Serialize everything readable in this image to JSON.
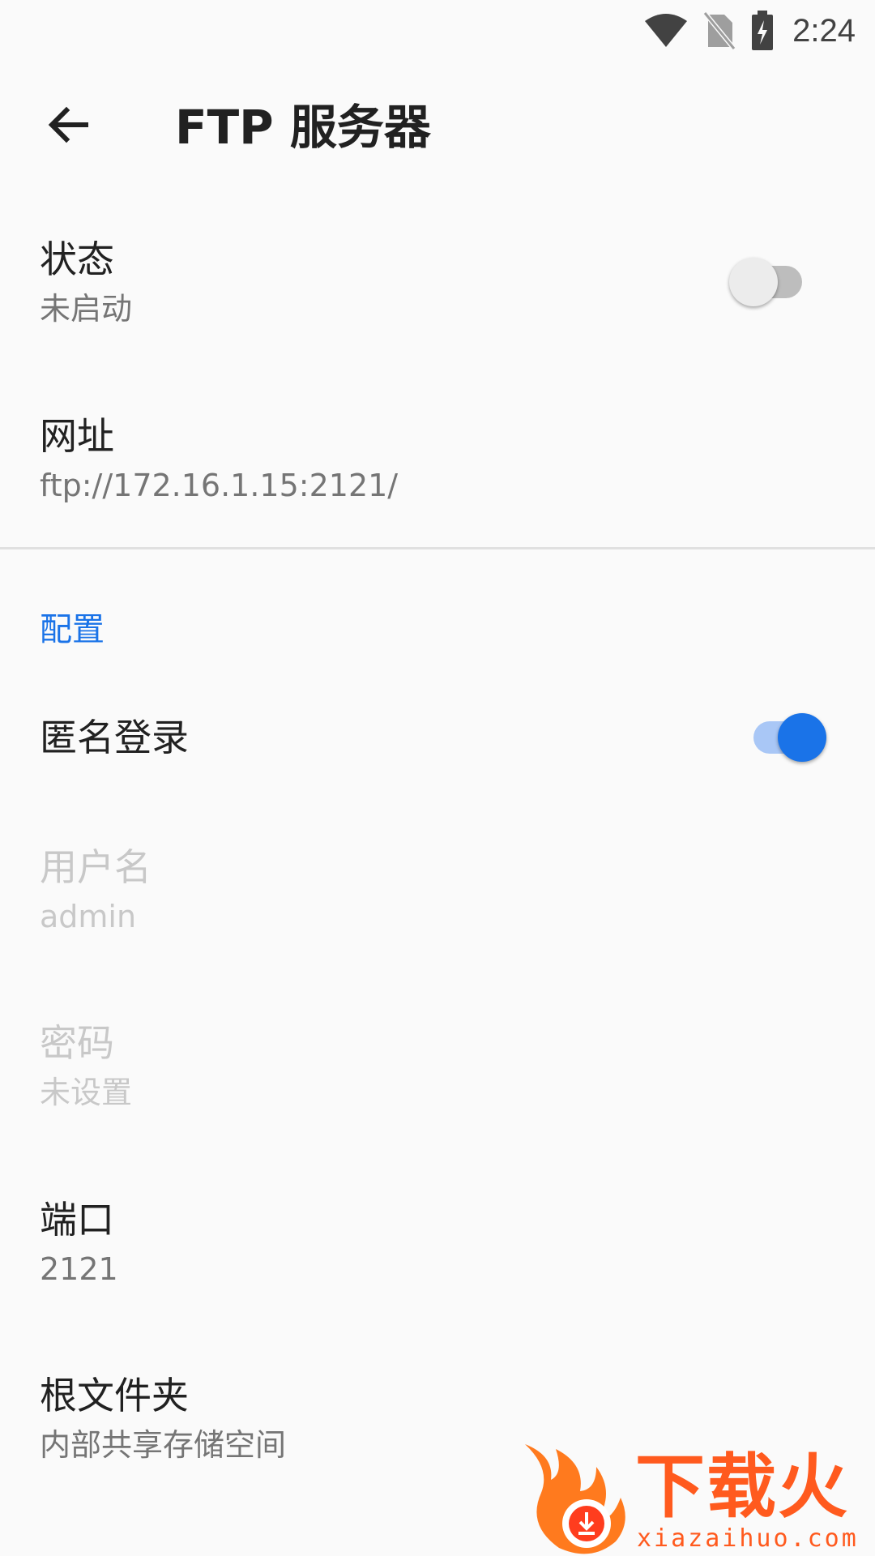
{
  "status_bar": {
    "time": "2:24",
    "icons": [
      "wifi-icon",
      "no-sim-icon",
      "battery-charging-icon"
    ]
  },
  "app_bar": {
    "back_icon": "arrow-back-icon",
    "title": "FTP 服务器"
  },
  "status": {
    "title": "状态",
    "summary": "未启动",
    "enabled": false
  },
  "url": {
    "title": "网址",
    "summary": "ftp://172.16.1.15:2121/"
  },
  "config": {
    "header": "配置",
    "anonymous_login": {
      "title": "匿名登录",
      "enabled": true
    },
    "username": {
      "title": "用户名",
      "summary": "admin",
      "disabled": true
    },
    "password": {
      "title": "密码",
      "summary": "未设置",
      "disabled": true
    },
    "port": {
      "title": "端口",
      "summary": "2121"
    },
    "root_folder": {
      "title": "根文件夹",
      "summary": "内部共享存储空间"
    }
  },
  "watermark": {
    "brand": "下载火",
    "domain": "xiazaihuo.com"
  },
  "colors": {
    "accent": "#1a73e8",
    "accent_track": "#a9c7f6",
    "text_primary": "#212121",
    "text_secondary": "#757575",
    "text_disabled": "#c8c8c8",
    "background": "#fafafa",
    "watermark": "#ff5a1e"
  }
}
